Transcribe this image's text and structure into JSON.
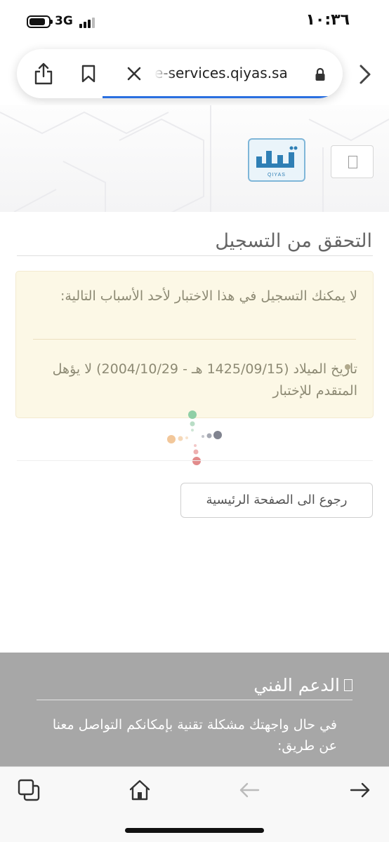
{
  "status_bar": {
    "time": "١٠:٣٦",
    "network": "3G",
    "battery_level": 0.85,
    "signal_bars": 3
  },
  "browser": {
    "url": "e-services.qiyas.sa",
    "load_progress": 0.7
  },
  "header": {
    "logo_caption": "QIYAS",
    "logo_text": "قياس"
  },
  "main": {
    "title": "التحقق من التسجيل",
    "alert_message": "لا يمكنك التسجيل في هذا الاختبار لأحد الأسباب التالية:",
    "reasons": [
      "تاريخ الميلاد (1425/09/15 هـ - 2004/10/29) لا يؤهل المتقدم للإختبار"
    ],
    "home_button_label": "رجوع الى الصفحة الرئيسية"
  },
  "support": {
    "title": "الدعم الفني",
    "text": "في حال واجهتك مشكلة تقنية بإمكانكم التواصل معنا عن طريق:"
  },
  "toolbar": {
    "icons": [
      "tabs-icon",
      "home-icon",
      "back-arrow-icon",
      "forward-arrow-icon"
    ]
  },
  "colors": {
    "accent_blue": "#2a6fe0",
    "alert_background": "#fcf8e6",
    "support_background": "#a7a7a7",
    "logo_blue": "#2f7fb5"
  }
}
